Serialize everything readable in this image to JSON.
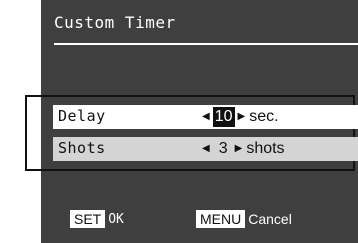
{
  "screen": {
    "title": "Custom Timer"
  },
  "settings": {
    "delay": {
      "label": "Delay",
      "value": "10",
      "unit": "sec."
    },
    "shots": {
      "label": "Shots",
      "value": "3",
      "unit": "shots"
    }
  },
  "footer": {
    "set_key": "SET",
    "set_action": "OK",
    "menu_key": "MENU",
    "menu_action": "Cancel"
  },
  "colors": {
    "screen_bg": "#3f3f3f",
    "highlight_row": "#ffffff",
    "secondary_row": "#d4d4d4",
    "text": "#111111"
  },
  "icons": {
    "left": "left-arrow-icon",
    "right": "right-arrow-icon"
  }
}
